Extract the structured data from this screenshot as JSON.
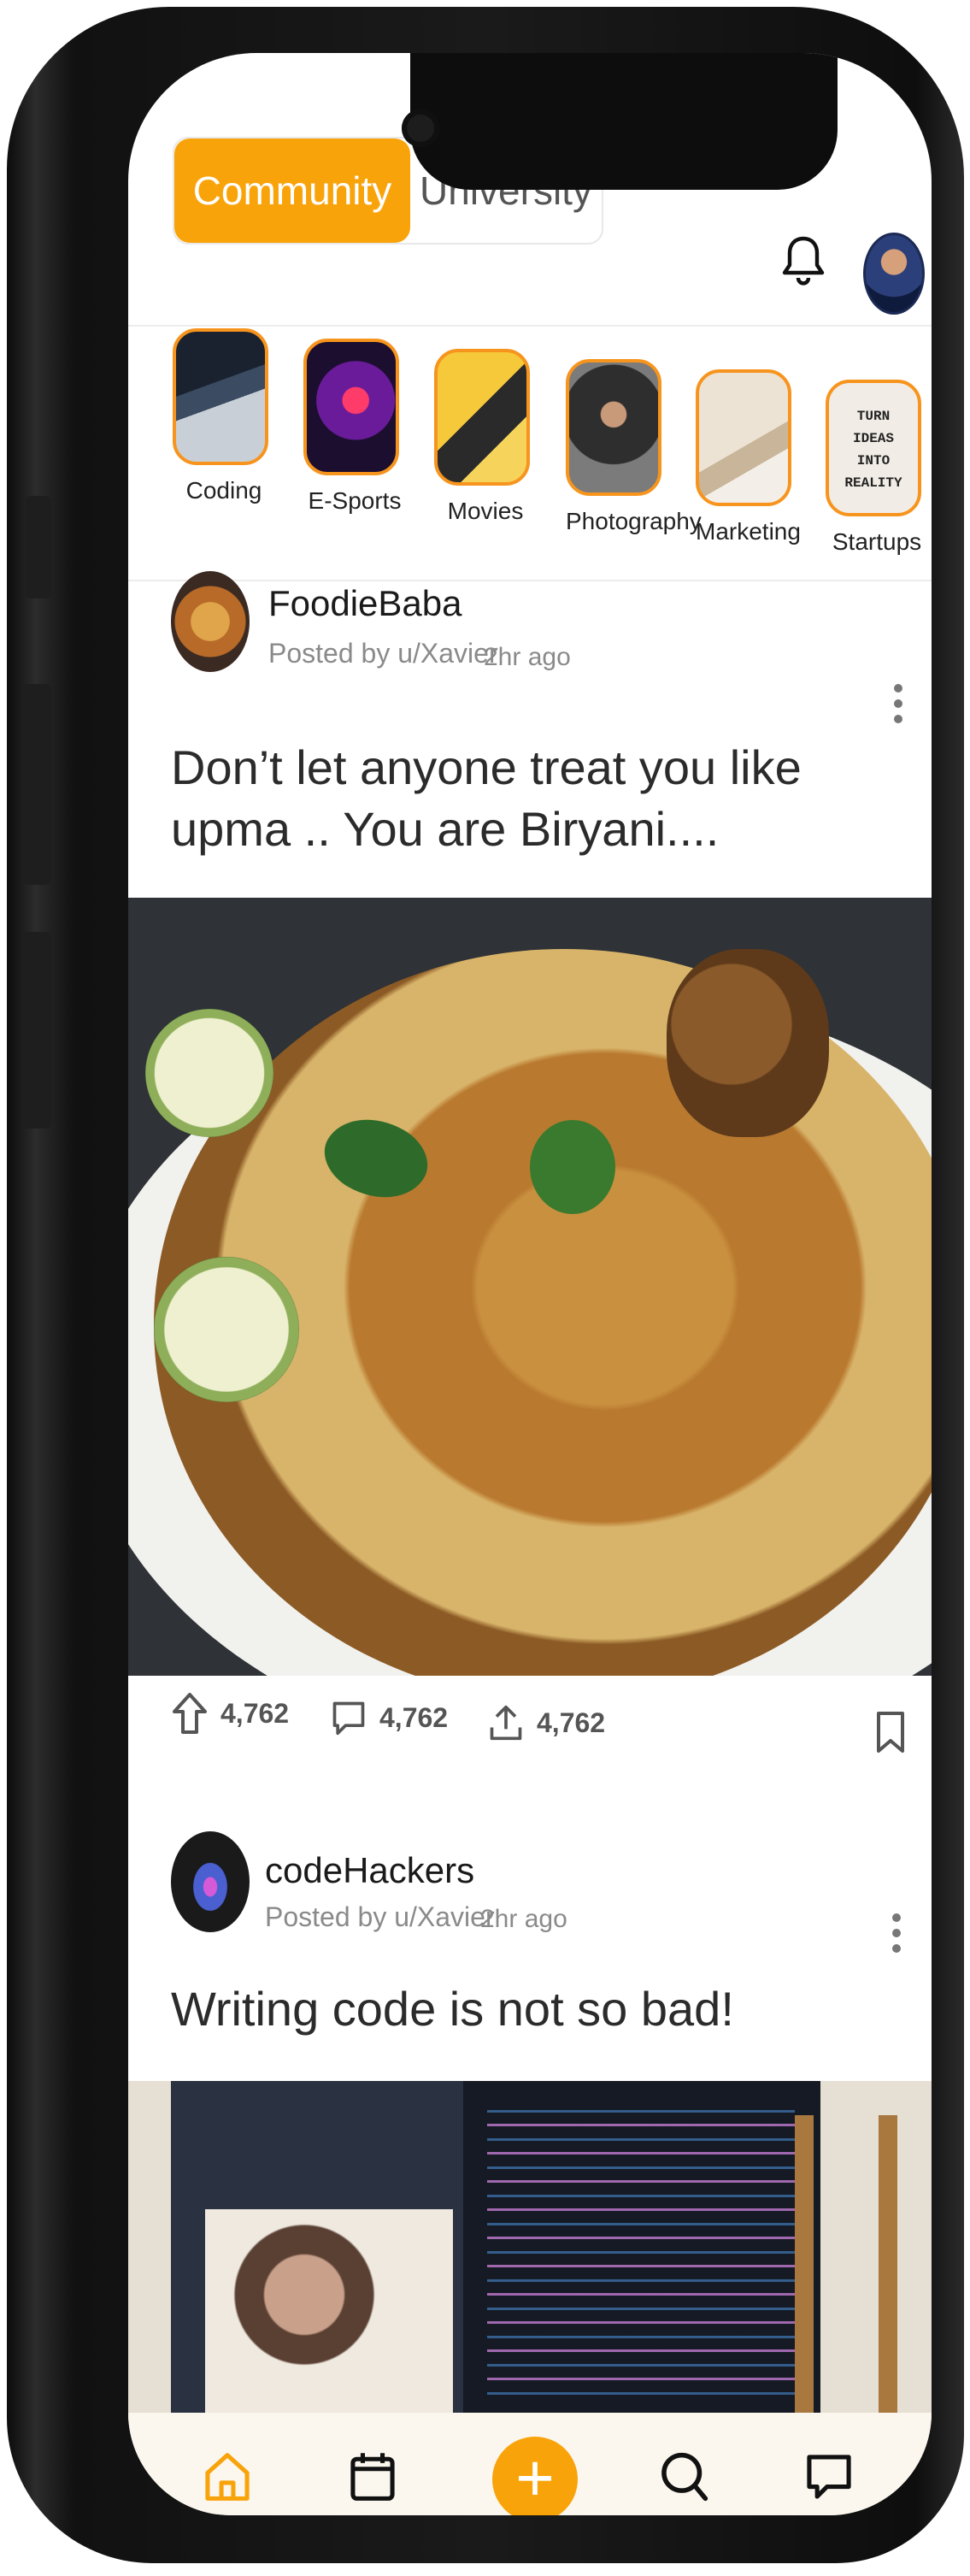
{
  "header": {
    "tabs": [
      {
        "label": "Community",
        "active": true
      },
      {
        "label": "University",
        "active": false
      }
    ],
    "accent_color": "#f9a30a"
  },
  "categories": [
    {
      "label": "Coding"
    },
    {
      "label": "E-Sports"
    },
    {
      "label": "Movies"
    },
    {
      "label": "Photography"
    },
    {
      "label": "Marketing"
    },
    {
      "label": "Startups"
    }
  ],
  "category_image_text": "TURN IDEAS INTO REALITY",
  "posts": [
    {
      "community": "FoodieBaba",
      "author": "Posted by u/Xavier",
      "time": "2hr ago",
      "title": "Don’t let anyone treat you like upma .. You are Biryani....",
      "upvotes": "4,762",
      "comments": "4,762",
      "shares": "4,762"
    },
    {
      "community": "codeHackers",
      "author": "Posted by u/Xavier",
      "time": "2hr ago",
      "title": "Writing code is not so bad!"
    }
  ],
  "bottom_nav": [
    {
      "name": "home-icon",
      "active": true
    },
    {
      "name": "calendar-icon",
      "active": false
    },
    {
      "name": "add-icon",
      "active": false
    },
    {
      "name": "search-icon",
      "active": false
    },
    {
      "name": "chat-icon",
      "active": false
    }
  ],
  "fab_label": "+"
}
